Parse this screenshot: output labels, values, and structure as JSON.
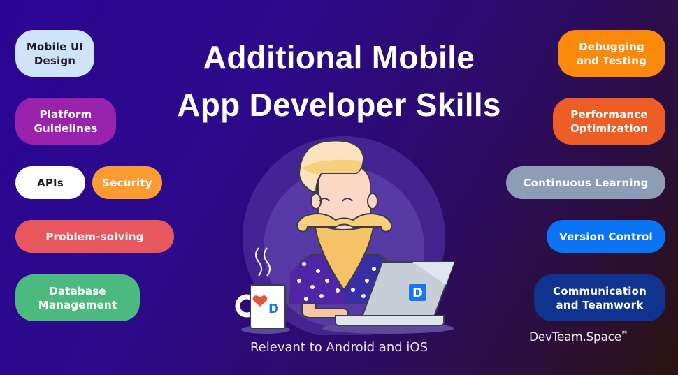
{
  "title": {
    "line1": "Additional Mobile",
    "line2": "App Developer Skills"
  },
  "left_skills": [
    {
      "label_line1": "Mobile UI",
      "label_line2": "Design",
      "color": "#cfe4fb",
      "text_color": "#1f1f2b"
    },
    {
      "label_line1": "Platform",
      "label_line2": "Guidelines",
      "color": "#9a23ad",
      "text_color": "#ffffff"
    },
    {
      "label_line1": "APIs",
      "label_line2": "",
      "color": "#ffffff",
      "text_color": "#1f1f2b"
    },
    {
      "label_line1": "Security",
      "label_line2": "",
      "color": "#fb9c31",
      "text_color": "#ffffff"
    },
    {
      "label_line1": "Problem-solving",
      "label_line2": "",
      "color": "#e8565e",
      "text_color": "#ffffff"
    },
    {
      "label_line1": "Database",
      "label_line2": "Management",
      "color": "#4cb97e",
      "text_color": "#ffffff"
    }
  ],
  "right_skills": [
    {
      "label_line1": "Debugging",
      "label_line2": "and Testing",
      "color": "#fb8a0c",
      "text_color": "#ffffff"
    },
    {
      "label_line1": "Performance",
      "label_line2": "Optimization",
      "color": "#ee5d26",
      "text_color": "#ffffff"
    },
    {
      "label_line1": "Continuous Learning",
      "label_line2": "",
      "color": "#8d9db5",
      "text_color": "#ffffff"
    },
    {
      "label_line1": "Version Control",
      "label_line2": "",
      "color": "#0a74f5",
      "text_color": "#ffffff"
    },
    {
      "label_line1": "Communication",
      "label_line2": "and Teamwork",
      "color": "#10338f",
      "text_color": "#ffffff"
    }
  ],
  "illustration": {
    "description": "Bearded developer with laptop and coffee mug",
    "mug_logo": "D",
    "laptop_logo": "D",
    "accent_blue": "#1677f2",
    "heart_color": "#e5533f"
  },
  "subtitle": "Relevant to Android and iOS",
  "brand": {
    "name": "DevTeam.Space",
    "mark": "®"
  }
}
